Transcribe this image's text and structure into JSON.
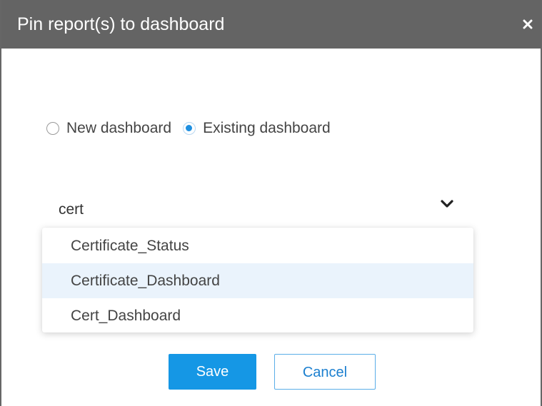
{
  "dialog": {
    "title": "Pin report(s) to dashboard",
    "close_icon": "close-icon"
  },
  "radio": {
    "options": [
      {
        "label": "New dashboard",
        "checked": false
      },
      {
        "label": "Existing dashboard",
        "checked": true
      }
    ]
  },
  "select": {
    "value": "cert",
    "icon": "chevron-down-icon"
  },
  "dropdown": {
    "options": [
      {
        "label": "Certificate_Status",
        "highlighted": false
      },
      {
        "label": "Certificate_Dashboard",
        "highlighted": true
      },
      {
        "label": "Cert_Dashboard",
        "highlighted": false
      }
    ]
  },
  "buttons": {
    "save_label": "Save",
    "cancel_label": "Cancel"
  },
  "colors": {
    "titlebar": "#646464",
    "accent": "#1597e5",
    "highlight": "#eaf3fc"
  }
}
